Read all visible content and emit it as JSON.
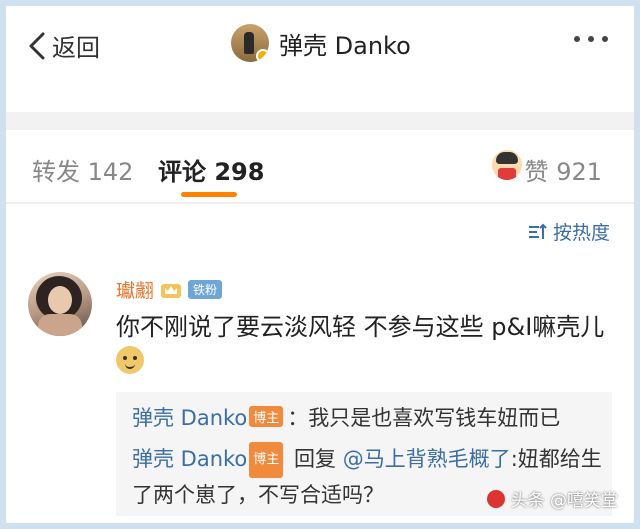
{
  "header": {
    "back_label": "返回",
    "title": "弹壳 Danko"
  },
  "tabs": [
    {
      "label": "转发",
      "count": "142"
    },
    {
      "label": "评论",
      "count": "298"
    }
  ],
  "likes": {
    "label": "赞",
    "count": "921"
  },
  "sort_label": "按热度",
  "comment": {
    "author": "瓛翽",
    "badge": "铁粉",
    "text": "你不刚说了要云淡风轻 不参与这些 p&I嘛壳儿"
  },
  "replies": [
    {
      "author": "弹壳 Danko",
      "badge": "博主",
      "text": "：我只是也喜欢写钱车妞而已"
    },
    {
      "author": "弹壳 Danko",
      "badge": "博主",
      "prefix": "回复",
      "mention": "@马上背熟毛概了",
      "text": ":妞都给生了两个崽了，不写合适吗？"
    }
  ],
  "watermark": "头条 @嘻笑堂",
  "colors": {
    "accent": "#ff8200",
    "link": "#3a6ea5",
    "author": "#e8762b"
  }
}
